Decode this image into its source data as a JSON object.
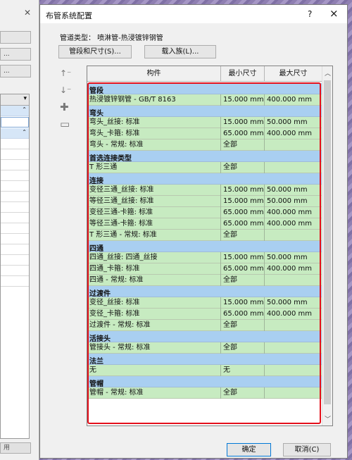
{
  "background_window": {
    "buttons": [
      "",
      "...",
      "..."
    ],
    "bottom_label": "用"
  },
  "dialog": {
    "title": "布管系统配置",
    "help": "?",
    "close": "×",
    "pipe_type": "管道类型：  喷淋管-热浸镀锌钢管",
    "segments_button": "管段和尺寸(S)...",
    "load_family_button": "载入族(L)...",
    "ok": "确定",
    "cancel": "取消(C)"
  },
  "table": {
    "headers": [
      "构件",
      "最小尺寸",
      "最大尺寸"
    ],
    "rows": [
      {
        "type": "group",
        "name": "管段"
      },
      {
        "type": "item",
        "name": "热浸镀锌钢管 - GB/T 8163",
        "min": "15.000 mm",
        "max": "400.000 mm"
      },
      {
        "type": "group",
        "name": "弯头"
      },
      {
        "type": "item",
        "name": "弯头_丝接: 标准",
        "min": "15.000 mm",
        "max": "50.000 mm"
      },
      {
        "type": "item",
        "name": "弯头_卡箍: 标准",
        "min": "65.000 mm",
        "max": "400.000 mm"
      },
      {
        "type": "item",
        "name": "弯头 - 常规: 标准",
        "min": "全部",
        "max": ""
      },
      {
        "type": "group",
        "name": "首选连接类型"
      },
      {
        "type": "item",
        "name": "T 形三通",
        "min": "全部",
        "max": ""
      },
      {
        "type": "group",
        "name": "连接"
      },
      {
        "type": "item",
        "name": "变径三通_丝接: 标准",
        "min": "15.000 mm",
        "max": "50.000 mm"
      },
      {
        "type": "item",
        "name": "等径三通_丝接: 标准",
        "min": "15.000 mm",
        "max": "50.000 mm"
      },
      {
        "type": "item",
        "name": "变径三通-卡箍: 标准",
        "min": "65.000 mm",
        "max": "400.000 mm"
      },
      {
        "type": "item",
        "name": "等径三通-卡箍: 标准",
        "min": "65.000 mm",
        "max": "400.000 mm"
      },
      {
        "type": "item",
        "name": "T 形三通 - 常规: 标准",
        "min": "全部",
        "max": ""
      },
      {
        "type": "group",
        "name": "四通"
      },
      {
        "type": "item",
        "name": "四通_丝接: 四通_丝接",
        "min": "15.000 mm",
        "max": "50.000 mm"
      },
      {
        "type": "item",
        "name": "四通_卡箍: 标准",
        "min": "65.000 mm",
        "max": "400.000 mm"
      },
      {
        "type": "item",
        "name": "四通 - 常规: 标准",
        "min": "全部",
        "max": ""
      },
      {
        "type": "group",
        "name": "过渡件"
      },
      {
        "type": "item",
        "name": "变径_丝接: 标准",
        "min": "15.000 mm",
        "max": "50.000 mm"
      },
      {
        "type": "item",
        "name": "变径_卡箍: 标准",
        "min": "65.000 mm",
        "max": "400.000 mm"
      },
      {
        "type": "item",
        "name": "过渡件 - 常规: 标准",
        "min": "全部",
        "max": ""
      },
      {
        "type": "group",
        "name": "活接头"
      },
      {
        "type": "item",
        "name": "管接头 - 常规: 标准",
        "min": "全部",
        "max": ""
      },
      {
        "type": "group",
        "name": "法兰"
      },
      {
        "type": "item",
        "name": "无",
        "min": "无",
        "max": ""
      },
      {
        "type": "group",
        "name": "管帽"
      },
      {
        "type": "item",
        "name": "管帽 - 常规: 标准",
        "min": "全部",
        "max": ""
      }
    ]
  },
  "colors": {
    "group_row": "#a9cff1",
    "item_row": "#c7ebc1",
    "highlight": "#e4101b"
  },
  "icons": [
    "move-up-icon",
    "move-down-icon",
    "add-row-icon",
    "remove-row-icon"
  ]
}
